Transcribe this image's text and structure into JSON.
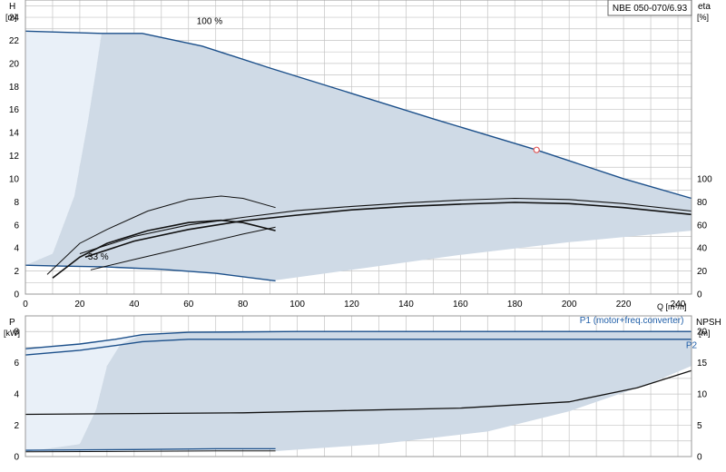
{
  "product_label": "NBE 050-070/6.93",
  "colors": {
    "envelope_fill": "#cfdae6",
    "light_fill": "#e9f0f8",
    "curve_blue": "#1b4f8a",
    "curve_dark": "#111111",
    "grid": "#c4c4c4",
    "frame": "#999999",
    "duty_point": "#e05a5a",
    "label_blue": "#1f5ea8"
  },
  "chart_data": [
    {
      "type": "line",
      "id": "head",
      "x_axis": {
        "label": "Q [m³/h]",
        "range": [
          0,
          245
        ],
        "ticks": [
          0,
          20,
          40,
          60,
          80,
          100,
          120,
          140,
          160,
          180,
          200,
          220,
          240
        ],
        "grid_step": 10
      },
      "y_axis_left": {
        "label_top": "H",
        "label_unit": "[m]",
        "range": [
          0,
          25.5
        ],
        "ticks": [
          0,
          2,
          4,
          6,
          8,
          10,
          12,
          14,
          16,
          18,
          20,
          22,
          24
        ],
        "grid_step": 1
      },
      "y_axis_right": {
        "label_top": "eta",
        "label_unit": "[%]",
        "range": [
          0,
          255
        ],
        "ticks": [
          0,
          20,
          40,
          60,
          80,
          100
        ]
      },
      "grid": true,
      "series": [
        {
          "role": "envelope_upper",
          "points": [
            [
              0,
              22.8
            ],
            [
              28,
              22.6
            ],
            [
              43,
              22.6
            ],
            [
              65,
              21.5
            ],
            [
              90,
              19.6
            ],
            [
              120,
              17.4
            ],
            [
              150,
              15.2
            ],
            [
              188,
              12.5
            ],
            [
              220,
              10.0
            ],
            [
              245,
              8.3
            ]
          ]
        },
        {
          "role": "envelope_lower_max",
          "points": [
            [
              92,
              1.2
            ],
            [
              120,
              2.1
            ],
            [
              160,
              3.4
            ],
            [
              200,
              4.5
            ],
            [
              245,
              5.5
            ]
          ]
        },
        {
          "role": "min_speed_head",
          "points": [
            [
              0,
              2.5
            ],
            [
              10,
              2.45
            ],
            [
              30,
              2.35
            ],
            [
              50,
              2.15
            ],
            [
              70,
              1.8
            ],
            [
              92,
              1.15
            ]
          ]
        },
        {
          "role": "left_boundary",
          "points": [
            [
              0,
              2.5
            ],
            [
              10,
              3.5
            ],
            [
              18,
              8.5
            ],
            [
              23,
              15.0
            ],
            [
              26,
              19.5
            ],
            [
              28,
              22.6
            ]
          ]
        },
        {
          "role": "eta_max_speed",
          "points": [
            [
              20,
              3.5
            ],
            [
              40,
              5.0
            ],
            [
              60,
              6.0
            ],
            [
              80,
              6.65
            ],
            [
              100,
              7.25
            ],
            [
              120,
              7.6
            ],
            [
              140,
              7.9
            ],
            [
              160,
              8.15
            ],
            [
              180,
              8.3
            ],
            [
              200,
              8.2
            ],
            [
              220,
              7.85
            ],
            [
              245,
              7.2
            ]
          ]
        },
        {
          "role": "eta_max_speed_inner",
          "points": [
            [
              22,
              3.2
            ],
            [
              40,
              4.6
            ],
            [
              60,
              5.6
            ],
            [
              80,
              6.35
            ],
            [
              100,
              6.85
            ],
            [
              120,
              7.3
            ],
            [
              140,
              7.6
            ],
            [
              160,
              7.8
            ],
            [
              180,
              7.95
            ],
            [
              200,
              7.85
            ],
            [
              220,
              7.5
            ],
            [
              245,
              6.9
            ]
          ]
        },
        {
          "role": "eta_min_speed",
          "points": [
            [
              8,
              1.7
            ],
            [
              20,
              4.4
            ],
            [
              30,
              5.6
            ],
            [
              45,
              7.2
            ],
            [
              60,
              8.2
            ],
            [
              72,
              8.5
            ],
            [
              80,
              8.3
            ],
            [
              92,
              7.5
            ]
          ]
        },
        {
          "role": "eta_min_speed_inner",
          "points": [
            [
              10,
              1.4
            ],
            [
              20,
              3.2
            ],
            [
              30,
              4.4
            ],
            [
              45,
              5.5
            ],
            [
              60,
              6.2
            ],
            [
              72,
              6.4
            ],
            [
              80,
              6.2
            ],
            [
              92,
              5.5
            ]
          ]
        },
        {
          "role": "eta_small_cross",
          "points": [
            [
              24,
              2.1
            ],
            [
              40,
              3.0
            ],
            [
              60,
              4.1
            ],
            [
              80,
              5.2
            ],
            [
              92,
              5.8
            ]
          ]
        }
      ],
      "annotations": [
        {
          "text": "100 %",
          "x": 63,
          "y": 23.4
        },
        {
          "text": "33 %",
          "x": 23,
          "y": 3.0
        }
      ],
      "duty_point": {
        "x": 188,
        "y": 12.5
      }
    },
    {
      "type": "line",
      "id": "power",
      "x_axis": {
        "range": [
          0,
          245
        ],
        "grid_step": 10
      },
      "y_axis_left": {
        "label_top": "P",
        "label_unit": "[kW]",
        "range": [
          0,
          9.0
        ],
        "ticks": [
          0,
          2,
          4,
          6,
          8
        ],
        "grid_step": 1
      },
      "y_axis_right": {
        "label_top": "NPSH",
        "label_unit": "[m]",
        "range": [
          0,
          22.5
        ],
        "ticks": [
          0,
          5,
          10,
          15,
          20
        ]
      },
      "grid": true,
      "series": [
        {
          "name": "P1 (motor+freq.converter)",
          "role": "p1_max",
          "points": [
            [
              0,
              6.9
            ],
            [
              20,
              7.2
            ],
            [
              33,
              7.5
            ],
            [
              43,
              7.8
            ],
            [
              60,
              7.95
            ],
            [
              100,
              8.0
            ],
            [
              245,
              8.0
            ]
          ]
        },
        {
          "name": "P2",
          "role": "p2_max",
          "points": [
            [
              0,
              6.5
            ],
            [
              20,
              6.8
            ],
            [
              33,
              7.1
            ],
            [
              43,
              7.35
            ],
            [
              60,
              7.5
            ],
            [
              100,
              7.5
            ],
            [
              245,
              7.5
            ]
          ]
        },
        {
          "role": "p_envelope_lower",
          "points": [
            [
              92,
              0.35
            ],
            [
              130,
              0.8
            ],
            [
              170,
              1.6
            ],
            [
              200,
              2.9
            ],
            [
              230,
              4.7
            ],
            [
              245,
              5.8
            ]
          ]
        },
        {
          "role": "p1_min",
          "points": [
            [
              0,
              0.4
            ],
            [
              40,
              0.45
            ],
            [
              70,
              0.5
            ],
            [
              92,
              0.5
            ]
          ]
        },
        {
          "role": "p2_min",
          "points": [
            [
              0,
              0.3
            ],
            [
              40,
              0.33
            ],
            [
              70,
              0.36
            ],
            [
              92,
              0.36
            ]
          ]
        },
        {
          "role": "npsh",
          "points": [
            [
              0,
              2.7
            ],
            [
              40,
              2.75
            ],
            [
              80,
              2.8
            ],
            [
              120,
              2.95
            ],
            [
              160,
              3.1
            ],
            [
              200,
              3.5
            ],
            [
              225,
              4.4
            ],
            [
              245,
              5.5
            ]
          ]
        }
      ],
      "left_boundary": [
        [
          0,
          0.3
        ],
        [
          20,
          0.8
        ],
        [
          26,
          3.0
        ],
        [
          30,
          5.8
        ],
        [
          35,
          7.2
        ],
        [
          43,
          7.8
        ]
      ],
      "series_labels": [
        {
          "text": "P1 (motor+freq.converter)",
          "x": 223,
          "y": 8.55
        },
        {
          "text": "P2",
          "x": 245,
          "y": 6.95
        }
      ]
    }
  ]
}
